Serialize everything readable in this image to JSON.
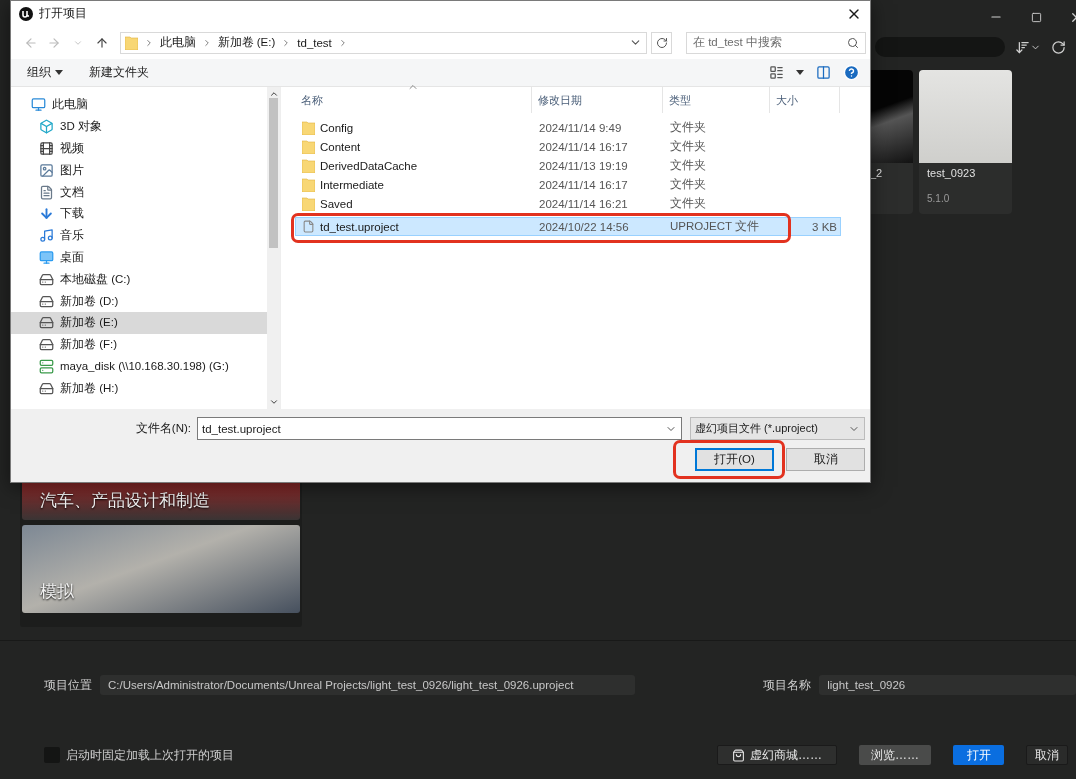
{
  "launcher": {
    "projects": [
      {
        "name": "_2"
      },
      {
        "name": "test_0923",
        "version": "5.1.0"
      }
    ],
    "categories": [
      {
        "label": "汽车、产品设计和制造",
        "kind": "car"
      },
      {
        "label": "模拟",
        "kind": "plane"
      }
    ],
    "project_location": {
      "label": "项目位置",
      "value": "C:/Users/Administrator/Documents/Unreal Projects/light_test_0926/light_test_0926.uproject"
    },
    "project_name": {
      "label": "项目名称",
      "value": "light_test_0926"
    },
    "startup_option": {
      "label": "启动时固定加载上次打开的项目",
      "checked": false
    },
    "buttons": [
      {
        "label": "虚幻商城……",
        "kind": "store"
      },
      {
        "label": "浏览……",
        "kind": "secondary"
      },
      {
        "label": "打开",
        "kind": "primary"
      },
      {
        "label": "取消",
        "kind": "plain"
      }
    ]
  },
  "dialog": {
    "title": "打开项目",
    "breadcrumb": [
      "此电脑",
      "新加卷 (E:)",
      "td_test"
    ],
    "search": {
      "placeholder": "在 td_test 中搜索"
    },
    "toolbar": [
      {
        "label": "组织",
        "kind": "menu"
      },
      {
        "label": "新建文件夹",
        "kind": "plain"
      }
    ],
    "nav": [
      {
        "label": "此电脑",
        "kind": "computer",
        "selected": false,
        "children": [
          {
            "label": "3D 对象",
            "kind": "objects3d",
            "selected": false
          },
          {
            "label": "视频",
            "kind": "video",
            "selected": false
          },
          {
            "label": "图片",
            "kind": "pictures",
            "selected": false
          },
          {
            "label": "文档",
            "kind": "documents",
            "selected": false
          },
          {
            "label": "下载",
            "kind": "downloads",
            "selected": false
          },
          {
            "label": "音乐",
            "kind": "music",
            "selected": false
          },
          {
            "label": "桌面",
            "kind": "desktop",
            "selected": false
          },
          {
            "label": "本地磁盘 (C:)",
            "kind": "drive",
            "selected": false
          },
          {
            "label": "新加卷 (D:)",
            "kind": "drive",
            "selected": false
          },
          {
            "label": "新加卷 (E:)",
            "kind": "drive",
            "selected": true
          },
          {
            "label": "新加卷 (F:)",
            "kind": "drive",
            "selected": false
          },
          {
            "label": "maya_disk (\\\\10.168.30.198) (G:)",
            "kind": "network",
            "selected": false
          },
          {
            "label": "新加卷 (H:)",
            "kind": "drive",
            "selected": false
          }
        ]
      }
    ],
    "columns": [
      "名称",
      "修改日期",
      "类型",
      "大小"
    ],
    "files": [
      {
        "name": "Config",
        "modified": "2024/11/14 9:49",
        "type": "文件夹",
        "kind": "folder",
        "selected": false,
        "highlighted": false
      },
      {
        "name": "Content",
        "modified": "2024/11/14 16:17",
        "type": "文件夹",
        "kind": "folder",
        "selected": false,
        "highlighted": false
      },
      {
        "name": "DerivedDataCache",
        "modified": "2024/11/13 19:19",
        "type": "文件夹",
        "kind": "folder",
        "selected": false,
        "highlighted": false
      },
      {
        "name": "Intermediate",
        "modified": "2024/11/14 16:17",
        "type": "文件夹",
        "kind": "folder",
        "selected": false,
        "highlighted": false
      },
      {
        "name": "Saved",
        "modified": "2024/11/14 16:21",
        "type": "文件夹",
        "kind": "folder",
        "selected": false,
        "highlighted": false
      },
      {
        "name": "td_test.uproject",
        "modified": "2024/10/22 14:56",
        "type": "UPROJECT 文件",
        "size": "3 KB",
        "kind": "file",
        "selected": true,
        "highlighted": true
      }
    ],
    "file_name": {
      "label": "文件名(N):",
      "value": "td_test.uproject"
    },
    "file_type": "虚幻项目文件 (*.uproject)",
    "buttons": [
      {
        "label": "打开(O)",
        "default": true,
        "highlighted": true
      },
      {
        "label": "取消",
        "default": false,
        "highlighted": false
      }
    ]
  }
}
